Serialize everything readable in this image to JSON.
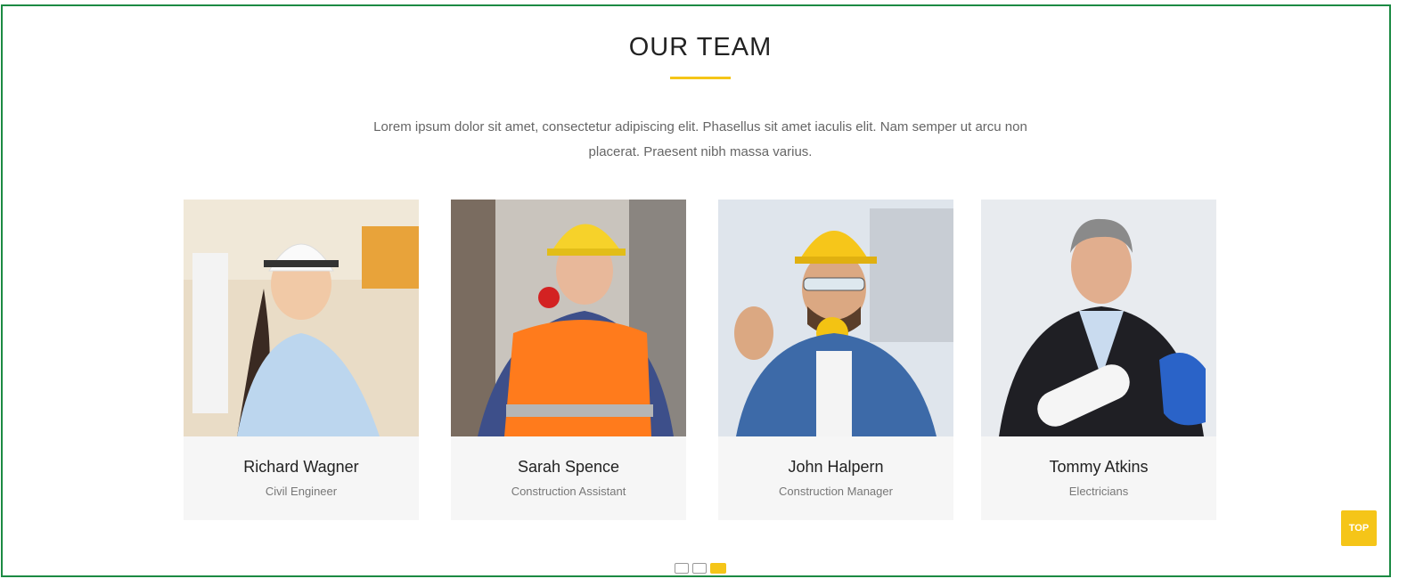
{
  "section": {
    "title": "OUR TEAM",
    "intro": "Lorem ipsum dolor sit amet, consectetur adipiscing elit. Phasellus sit amet iaculis elit. Nam semper ut arcu non placerat. Praesent nibh massa varius."
  },
  "team": [
    {
      "name": "Richard Wagner",
      "role": "Civil Engineer"
    },
    {
      "name": "Sarah Spence",
      "role": "Construction Assistant"
    },
    {
      "name": "John Halpern",
      "role": "Construction Manager"
    },
    {
      "name": "Tommy Atkins",
      "role": "Electricians"
    }
  ],
  "pager": {
    "active_index": 2
  },
  "back_to_top": {
    "label": "TOP"
  },
  "colors": {
    "accent": "#f5c518",
    "frame": "#1c8a43"
  }
}
